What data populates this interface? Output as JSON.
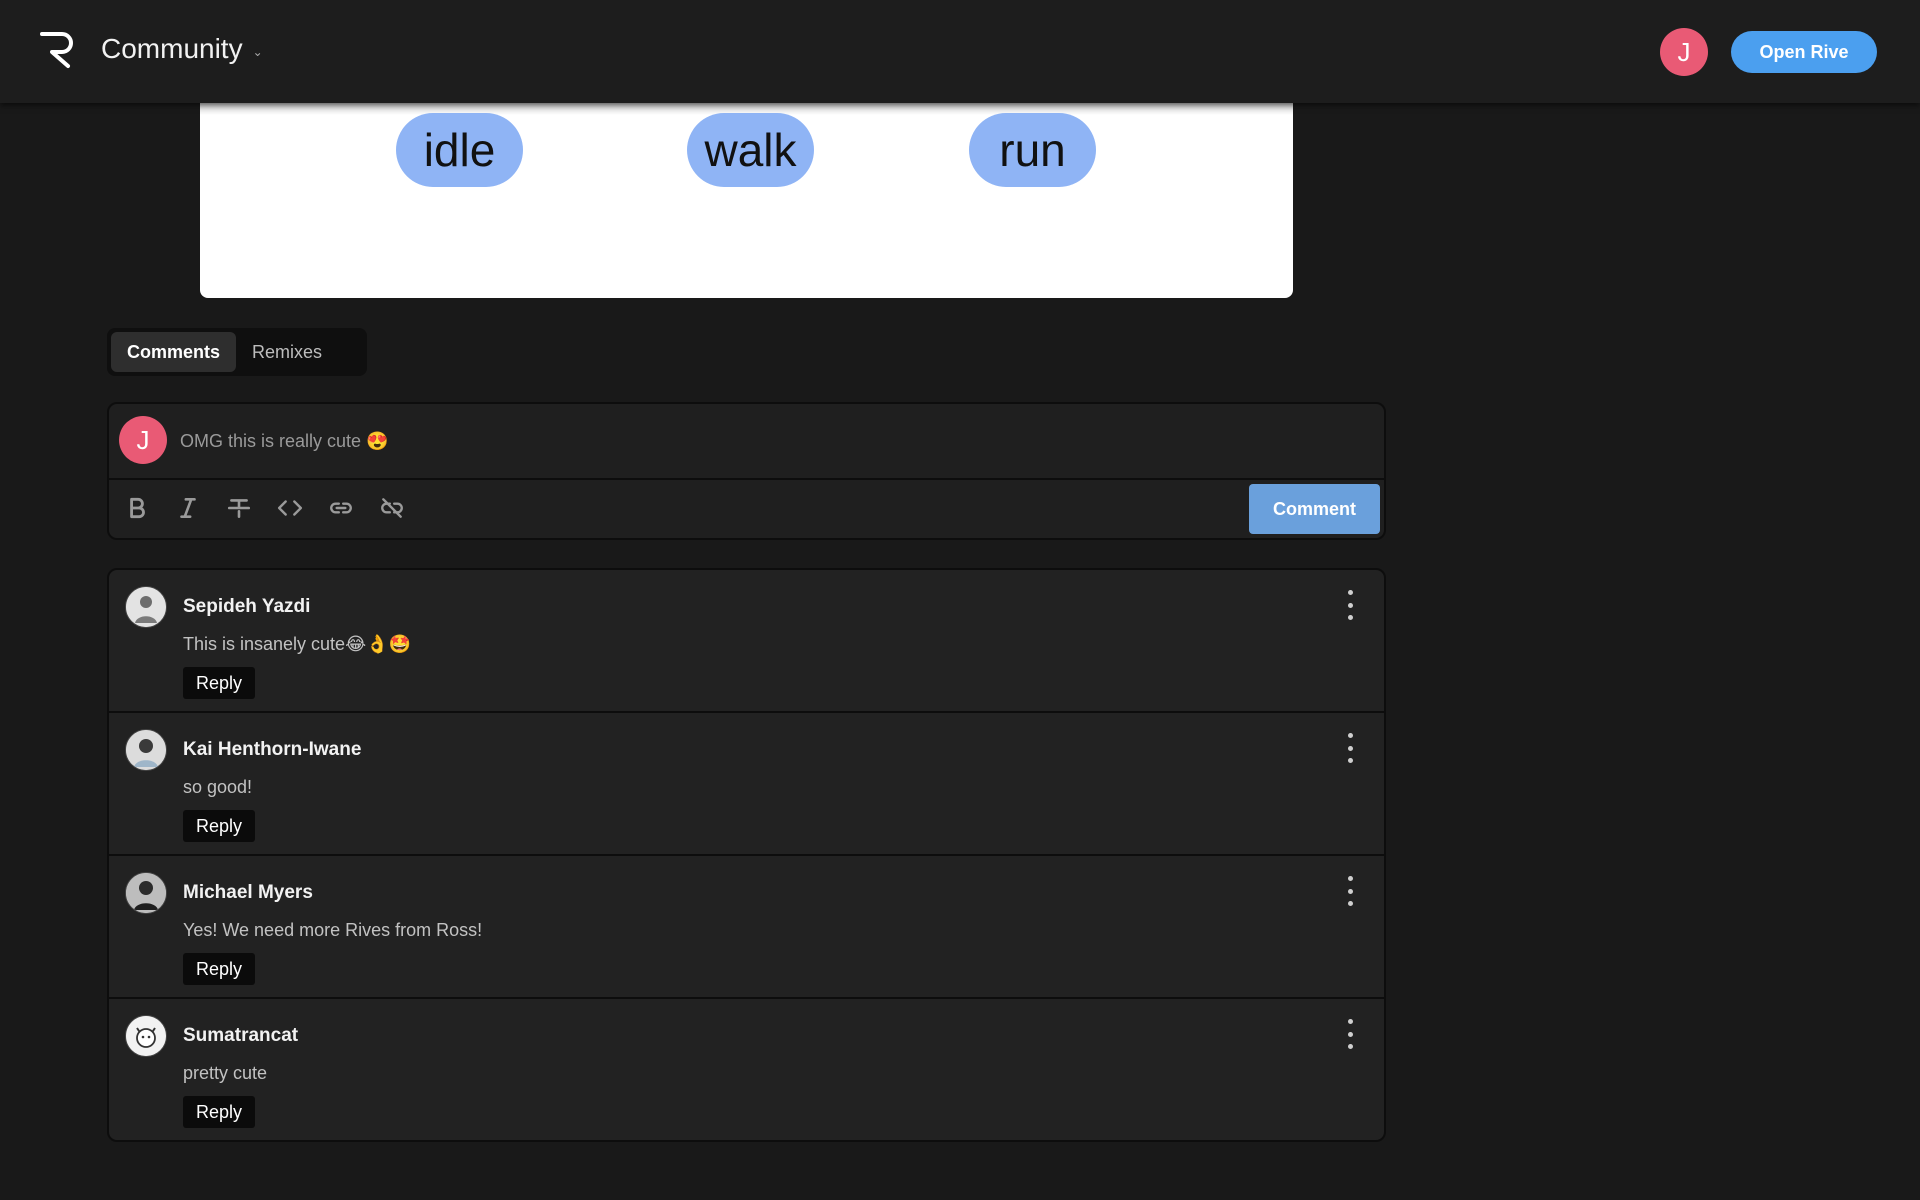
{
  "header": {
    "logo_icon": "rive-logo-icon",
    "title": "Community",
    "user_initial": "J",
    "open_button": "Open Rive"
  },
  "preview": {
    "states": [
      "idle",
      "walk",
      "run"
    ]
  },
  "tabs": [
    {
      "label": "Comments",
      "active": true
    },
    {
      "label": "Remixes",
      "active": false
    }
  ],
  "composer": {
    "user_initial": "J",
    "placeholder": "OMG this is really cute 😍",
    "tools": [
      "bold-icon",
      "italic-icon",
      "strikethrough-icon",
      "code-icon",
      "link-icon",
      "unlink-icon"
    ],
    "submit_label": "Comment"
  },
  "comments": [
    {
      "author": "Sepideh Yazdi",
      "text": "This is insanely cute😂👌🤩",
      "reply_label": "Reply"
    },
    {
      "author": "Kai Henthorn-Iwane",
      "text": "so good!",
      "reply_label": "Reply"
    },
    {
      "author": "Michael Myers",
      "text": "Yes! We need more Rives from Ross!",
      "reply_label": "Reply"
    },
    {
      "author": "Sumatrancat",
      "text": "pretty cute",
      "reply_label": "Reply"
    }
  ],
  "colors": {
    "accent": "#4b9fef",
    "avatar": "#e95a75",
    "state_pill": "#8fb4f5"
  }
}
